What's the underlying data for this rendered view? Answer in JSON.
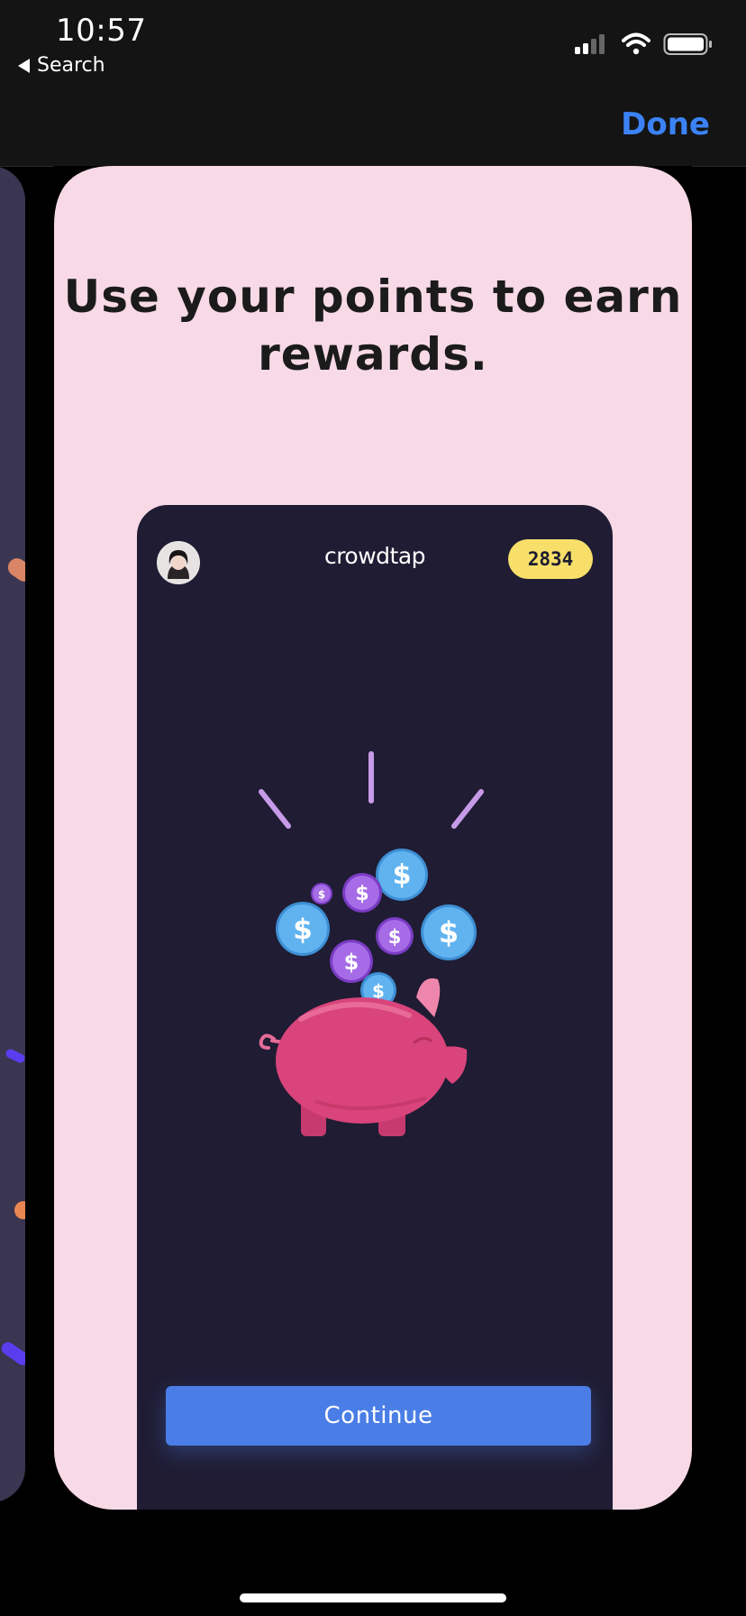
{
  "status_bar": {
    "time": "10:57",
    "back_label": "Search",
    "signal_icon": "signal-icon",
    "wifi_icon": "wifi-icon",
    "battery_icon": "battery-icon"
  },
  "nav": {
    "done_label": "Done"
  },
  "card": {
    "headline": "Use your points to earn rewards."
  },
  "app_preview": {
    "brand": "crowdtap",
    "points": "2834",
    "continue_label": "Continue"
  },
  "colors": {
    "card_background": "#f8d9e6",
    "phone_background": "#1f1c33",
    "accent_blue": "#4a7ee6",
    "done_blue": "#3b82f6",
    "points_yellow": "#f7df6a",
    "pig_pink": "#d8447b"
  }
}
